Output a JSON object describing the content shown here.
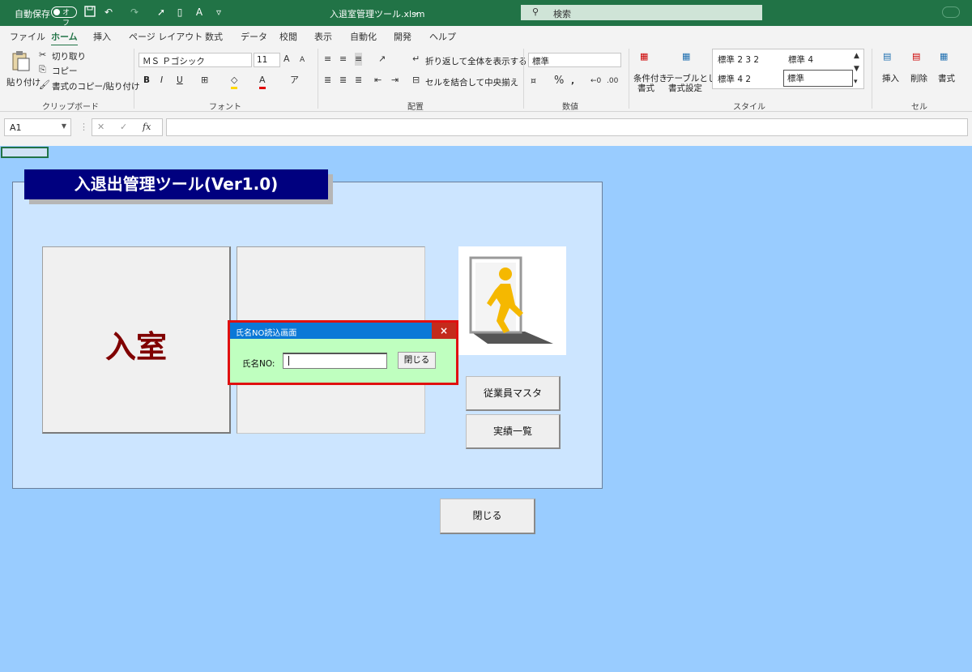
{
  "titlebar": {
    "autosave_label": "自動保存",
    "autosave_state": "オフ",
    "filename": "入退室管理ツール.xlsm",
    "search_placeholder": "検索"
  },
  "tabs": [
    "ファイル",
    "ホーム",
    "挿入",
    "ページ レイアウト",
    "数式",
    "データ",
    "校閲",
    "表示",
    "自動化",
    "開発",
    "ヘルプ"
  ],
  "ribbon": {
    "clipboard": {
      "paste": "貼り付け",
      "cut": "切り取り",
      "copy": "コピー",
      "format_painter": "書式のコピー/貼り付け",
      "label": "クリップボード"
    },
    "font": {
      "name": "ＭＳ Ｐゴシック",
      "size": "11",
      "bold": "B",
      "italic": "I",
      "underline": "U",
      "label": "フォント"
    },
    "alignment": {
      "wrap": "折り返して全体を表示する",
      "merge": "セルを結合して中央揃え",
      "label": "配置"
    },
    "number": {
      "format": "標準",
      "label": "数値"
    },
    "styles": {
      "cond_format": "条件付き",
      "cond_format2": "書式",
      "table_format": "テーブルとして",
      "table_format2": "書式設定",
      "style1": "標準 2 3 2",
      "style2": "標準 4",
      "style3": "標準 4 2",
      "style4": "標準",
      "label": "スタイル"
    },
    "cells": {
      "insert": "挿入",
      "delete": "削除",
      "format": "書式",
      "label": "セル"
    }
  },
  "formulabar": {
    "namebox": "A1",
    "fx": "fx"
  },
  "sheet": {
    "app_title": "入退出管理ツール(Ver1.0)",
    "enter_button": "入室",
    "employee_master": "従業員マスタ",
    "records_list": "実績一覧",
    "close_button": "閉じる"
  },
  "dialog": {
    "title": "氏名NO読込画面",
    "close": "×",
    "name_label": "氏名NO:",
    "name_value": "",
    "close_button": "閉じる"
  },
  "colors": {
    "excel_green": "#217346",
    "sheet_bg": "#99ccff",
    "panel_bg": "#cce5ff",
    "title_bg": "#00007f",
    "enter_text": "#800000",
    "dialog_bg": "#bfffbf",
    "dialog_border": "#e01010",
    "figure": "#f5b800"
  }
}
